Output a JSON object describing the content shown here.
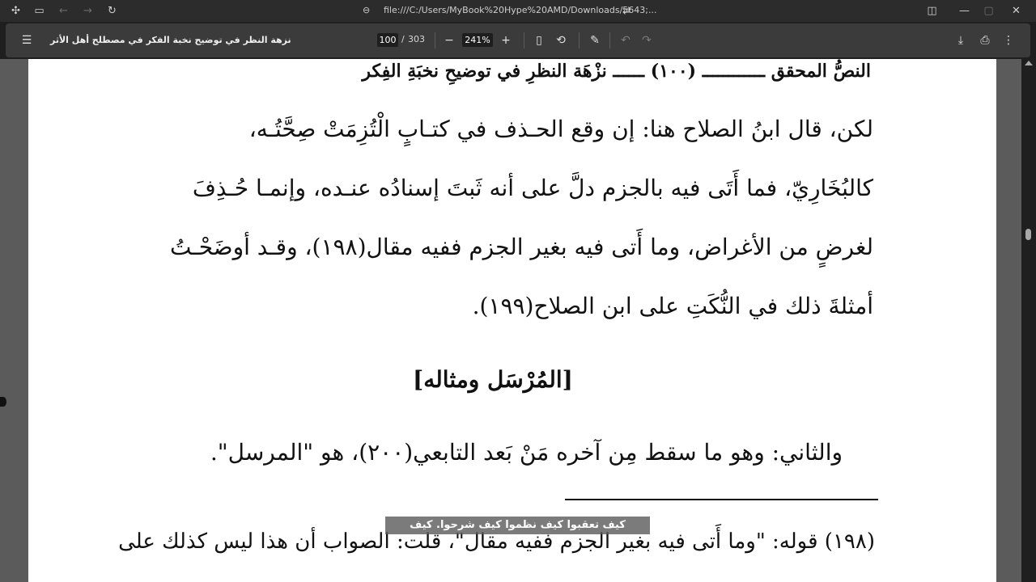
{
  "browser": {
    "url": "file:///C:/Users/MyBook%20Hype%20AMD/Downloads/5643;...",
    "icons": [
      "extensions-icon",
      "sidebar-icon",
      "back-icon",
      "forward-icon",
      "reload-icon",
      "link-icon",
      "tune-icon",
      "split-view-icon",
      "minimize-icon",
      "restore-icon",
      "close-icon"
    ]
  },
  "toolbar": {
    "document_title": "نزهة النظر في توضيح نخبة الفكر في مصطلح أهل الأثر",
    "page_current": "100",
    "page_separator": "/",
    "page_total": "303",
    "zoom": "241%"
  },
  "page": {
    "header": "النصُّ المحقق ــــــــــــ (١٠٠) ــــــ نزْهَة النظرِ في توضيحِ نخبَةِ الفِكر",
    "lines": [
      "لكن، قال ابنُ الصلاح هنا: إن وقع الحـذف في كتـابٍ الْتُزِمَتْ صِحَّتُـه،",
      "كالبُخَارِيّ، فما أَتَى فيه بالجزم دلَّ على أنه ثَبتَ إسنادُه عنـده، وإنمـا حُـذِفَ",
      "لغرضٍ من الأغراض، وما أَتى فيه بغير الجزم ففيه مقال(١٩٨)، وقـد أوضَحْـتُ",
      "أمثلةَ ذلك في النُّكَتِ على ابن الصلاح(١٩٩)."
    ],
    "section_heading": "[المُرْسَل ومثاله]",
    "second_para": "والثاني: وهو ما سقط مِن آخره مَنْ بَعد التابعي(٢٠٠)، هو \"المرسل\".",
    "footnote_1": "(١٩٨) قوله: \"وما أَتى فيه بغير الجزم ففيه مقال\"، قلت: الصواب أن هذا ليس كذلك على",
    "footnote_2": "ـــــــ ـــــــ ـــــــ"
  },
  "overlay": {
    "subtitle": "كيف تعقبوا كيف نظموا كيف شرحوا. كيف"
  }
}
